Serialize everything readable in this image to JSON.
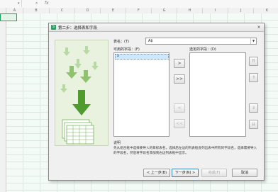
{
  "formula_bar": {
    "search_icon": "search-icon",
    "fx_label": "fx"
  },
  "columns": [
    "A",
    "B",
    "C",
    "D",
    "E",
    "F",
    "G",
    "H",
    "I",
    "J",
    "K"
  ],
  "dialog": {
    "title": "第二步：选择表和字段",
    "close_label": "×",
    "table_label": "表名：(T)",
    "table_value": "A$",
    "available_fields_label": "可用的字段：(F)",
    "available_fields": [
      "a"
    ],
    "selected_fields_label": "选定的字段：(D)",
    "move_buttons": [
      ">",
      ">>",
      "<",
      "<<"
    ],
    "order_buttons": [
      "⇈",
      "⇑",
      "⇓",
      "⇊"
    ],
    "description_title": "说明",
    "description_text": "先从组合框中选择要导入的目标表名，选择后左边的列表框会列出表中所有的字段名，选择需要导入的字段名，然后将字段名添加到右边列表框中显示。",
    "buttons": {
      "back": "< 上一步(B)",
      "next": "下一步(N) >",
      "finish": "完成(F)",
      "cancel": "取消"
    }
  },
  "colors": {
    "accent": "#2a9d63",
    "selection": "#cde8ff",
    "grid_bg": "#f4fbf6"
  }
}
